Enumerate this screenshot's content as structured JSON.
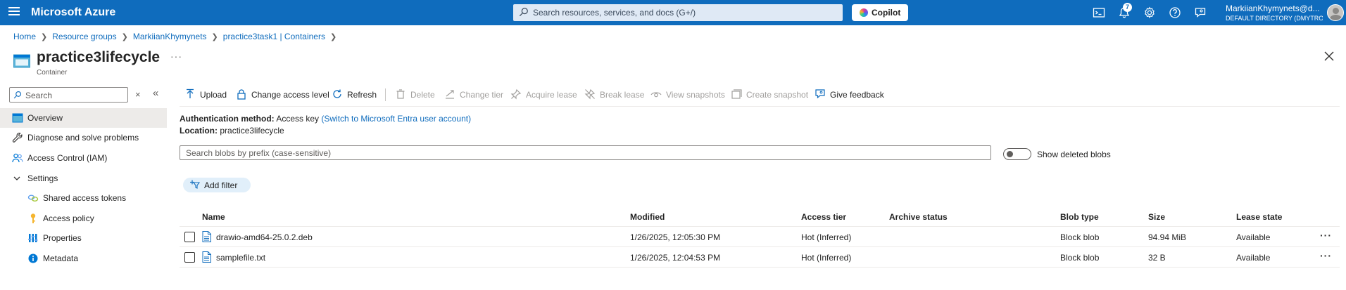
{
  "topbar": {
    "brand": "Microsoft Azure",
    "search_placeholder": "Search resources, services, and docs (G+/)",
    "copilot_label": "Copilot",
    "notifications_count": "7",
    "account_name": "MarkiianKhymynets@d...",
    "account_directory": "DEFAULT DIRECTORY (DMYTROS..."
  },
  "breadcrumb": [
    "Home",
    "Resource groups",
    "MarkiianKhymynets",
    "practice3task1 | Containers"
  ],
  "page": {
    "title": "practice3lifecycle",
    "subtitle": "Container",
    "more": "···"
  },
  "sidebar": {
    "search_placeholder": "Search",
    "clear": "×",
    "collapse": "«",
    "items": [
      {
        "label": "Overview",
        "icon": "container-icon",
        "active": true
      },
      {
        "label": "Diagnose and solve problems",
        "icon": "wrench-icon"
      },
      {
        "label": "Access Control (IAM)",
        "icon": "people-icon"
      },
      {
        "label": "Settings",
        "icon": "chevron-down-icon"
      },
      {
        "label": "Shared access tokens",
        "icon": "link-icon"
      },
      {
        "label": "Access policy",
        "icon": "key-icon"
      },
      {
        "label": "Properties",
        "icon": "properties-icon"
      },
      {
        "label": "Metadata",
        "icon": "info-icon"
      }
    ]
  },
  "commands": {
    "upload": "Upload",
    "change_access_level": "Change access level",
    "refresh": "Refresh",
    "delete": "Delete",
    "change_tier": "Change tier",
    "acquire_lease": "Acquire lease",
    "break_lease": "Break lease",
    "view_snapshots": "View snapshots",
    "create_snapshot": "Create snapshot",
    "give_feedback": "Give feedback"
  },
  "info": {
    "auth_label": "Authentication method:",
    "auth_value": "Access key",
    "auth_link": "(Switch to Microsoft Entra user account)",
    "location_label": "Location:",
    "location_value": "practice3lifecycle"
  },
  "blob_search_placeholder": "Search blobs by prefix (case-sensitive)",
  "show_deleted_label": "Show deleted blobs",
  "show_deleted_on": false,
  "add_filter_label": "Add filter",
  "table": {
    "columns": [
      "Name",
      "Modified",
      "Access tier",
      "Archive status",
      "Blob type",
      "Size",
      "Lease state"
    ],
    "rows": [
      {
        "name": "drawio-amd64-25.0.2.deb",
        "modified": "1/26/2025, 12:05:30 PM",
        "tier": "Hot (Inferred)",
        "archive": "",
        "type": "Block blob",
        "size": "94.94 MiB",
        "lease": "Available"
      },
      {
        "name": "samplefile.txt",
        "modified": "1/26/2025, 12:04:53 PM",
        "tier": "Hot (Inferred)",
        "archive": "",
        "type": "Block blob",
        "size": "32 B",
        "lease": "Available"
      }
    ],
    "row_more": "···"
  },
  "colors": {
    "header_bg": "#0f6cbd",
    "link": "#0f6cbd",
    "active_item_bg": "#edebe9",
    "filter_pill_bg": "#e1effa"
  }
}
